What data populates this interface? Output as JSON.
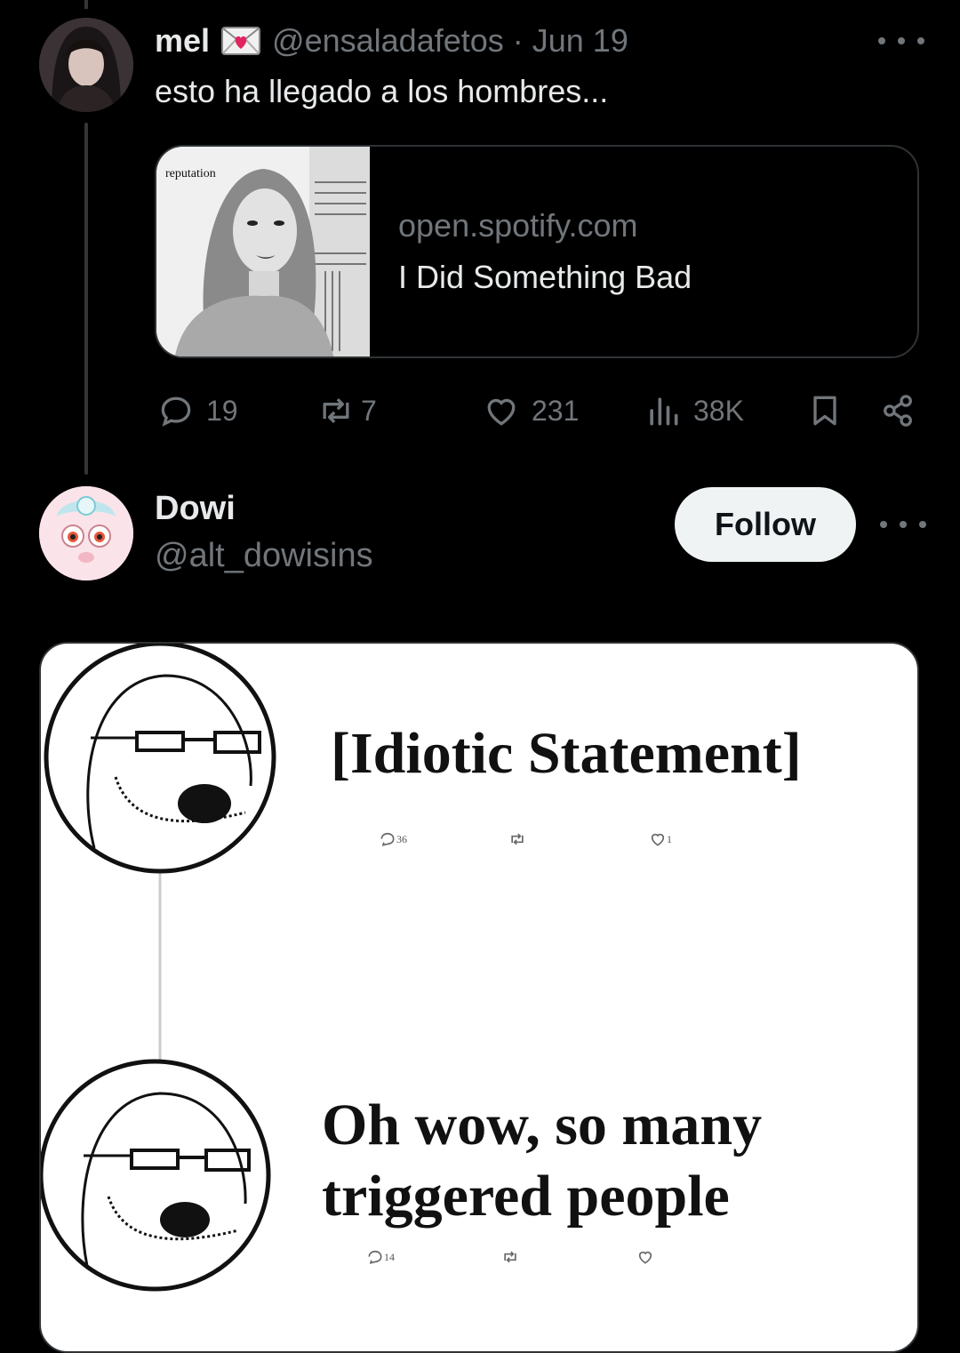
{
  "tweet": {
    "author_name": "mel",
    "author_handle": "@ensaladafetos",
    "separator": "·",
    "date": "Jun 19",
    "text": "esto ha llegado a los hombres...",
    "link_card": {
      "domain": "open.spotify.com",
      "title": "I Did Something Bad",
      "album_cover_text": "reputation"
    },
    "actions": {
      "replies": "19",
      "reposts": "7",
      "likes": "231",
      "views": "38K"
    }
  },
  "reply": {
    "author_name": "Dowi",
    "author_handle": "@alt_dowisins",
    "follow_label": "Follow",
    "meme": {
      "top_text": "[Idiotic Statement]",
      "top_counts": {
        "replies": "36",
        "likes": "1"
      },
      "bottom_text_line1": "Oh wow, so many",
      "bottom_text_line2": "triggered people",
      "bottom_counts": {
        "replies": "14"
      }
    }
  },
  "colors": {
    "background": "#000000",
    "text_primary": "#e7e9ea",
    "text_secondary": "#71767b",
    "border": "#2f3336",
    "follow_button_bg": "#eff3f4",
    "envelope_heart": "#e0245e"
  },
  "icons": [
    "envelope-heart-icon",
    "more-icon",
    "reply-icon",
    "repost-icon",
    "like-icon",
    "views-icon",
    "bookmark-icon",
    "share-icon"
  ]
}
